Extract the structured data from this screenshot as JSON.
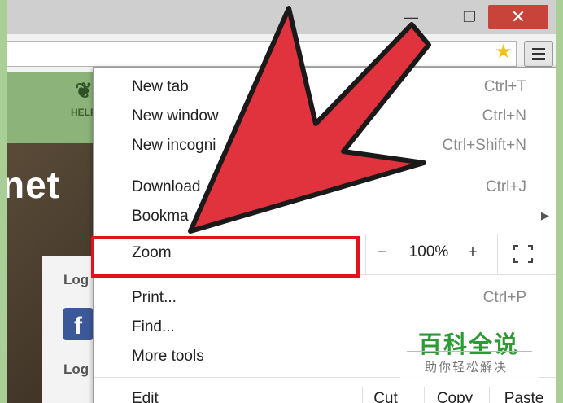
{
  "window": {
    "minimize_glyph": "—",
    "maximize_glyph": "❐",
    "close_glyph": "✕"
  },
  "toolbar": {
    "bookmark_icon": "star-icon",
    "menu_icon": "hamburger-icon"
  },
  "page": {
    "help_label": "HELP",
    "hero_text": "net",
    "login_label_1": "Log",
    "facebook_glyph": "f",
    "login_label_2": "Log"
  },
  "menu": {
    "items_top": [
      {
        "label": "New tab",
        "shortcut": "Ctrl+T"
      },
      {
        "label": "New window",
        "shortcut": "Ctrl+N"
      },
      {
        "label": "New incogni",
        "shortcut": "Ctrl+Shift+N"
      }
    ],
    "items_mid": [
      {
        "label": "Download",
        "shortcut": "Ctrl+J"
      },
      {
        "label": "Bookma",
        "shortcut": ""
      }
    ],
    "zoom": {
      "label": "Zoom",
      "minus": "−",
      "value": "100%",
      "plus": "+"
    },
    "items_bottom": [
      {
        "label": "Print...",
        "shortcut": "Ctrl+P"
      },
      {
        "label": "Find...",
        "shortcut": ""
      },
      {
        "label": "More tools",
        "shortcut": ""
      }
    ],
    "edit": {
      "label": "Edit",
      "cut": "Cut",
      "copy": "Copy",
      "paste": "Paste"
    }
  },
  "watermark": {
    "title": "百科全说",
    "subtitle": "助你轻松解决"
  },
  "colors": {
    "highlight": "#e1141b",
    "arrow_fill": "#e0333e",
    "watermark_green": "#2e9a36",
    "close_button": "#c8433a"
  }
}
